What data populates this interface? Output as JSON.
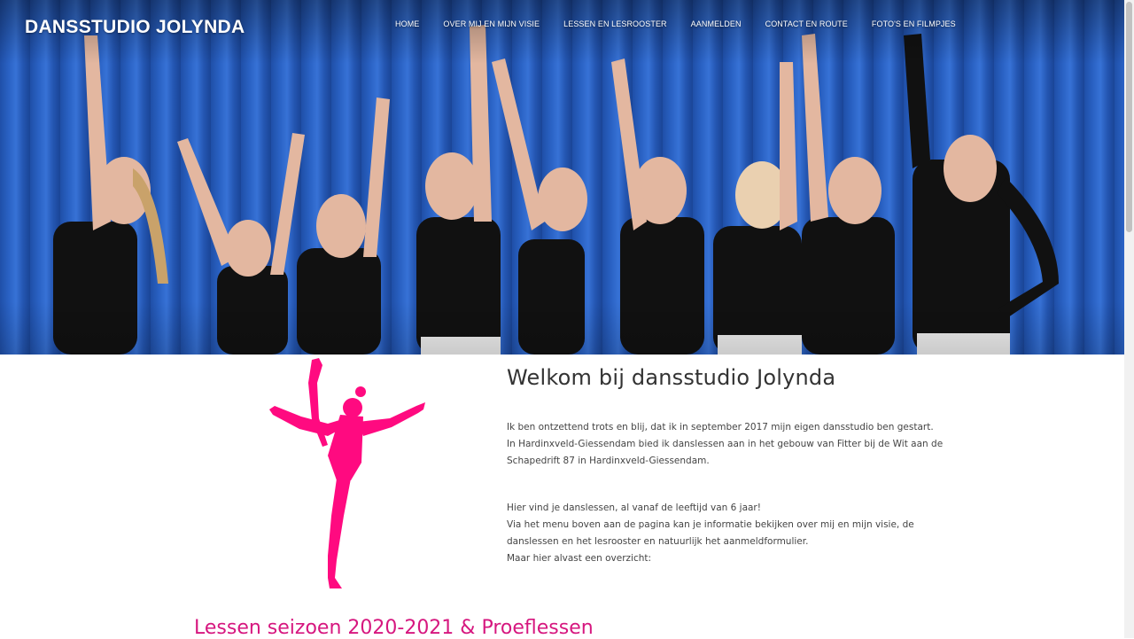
{
  "header": {
    "brand": "DANSSTUDIO JOLYNDA",
    "nav": [
      "HOME",
      "OVER MIJ EN MIJN VISIE",
      "LESSEN EN LESROOSTER",
      "AANMELDEN",
      "CONTACT EN ROUTE",
      "FOTO'S EN FILMPJES"
    ]
  },
  "hero": {
    "image": "photo of nine girls in black dance outfits with raised arms in front of a blue corrugated wall"
  },
  "main": {
    "title": "Welkom bij dansstudio Jolynda",
    "intro": [
      "Ik ben ontzettend trots en blij, dat ik in september 2017 mijn eigen dansstudio ben gestart.",
      "In Hardinxveld-Giessendam bied ik danslessen aan in het gebouw van Fitter bij de Wit aan de",
      "Schapedrift 87 in Hardinxveld-Giessendam."
    ],
    "info": [
      "Hier vind je danslessen, al vanaf de leeftijd van 6 jaar!",
      "Via het menu boven aan de pagina kan je informatie bekijken over mij en mijn visie, de",
      "danslessen en het lesrooster en natuurlijk het aanmeldformulier.",
      "Maar hier alvast een overzicht:"
    ],
    "season_title": "Lessen seizoen 2020-2021 & Proeflessen"
  },
  "colors": {
    "accent": "#ff0a80",
    "heading_pink": "#d6177f",
    "hero_blue": "#2a62c4"
  },
  "icons": {
    "logo": "dancer-silhouette-icon"
  }
}
